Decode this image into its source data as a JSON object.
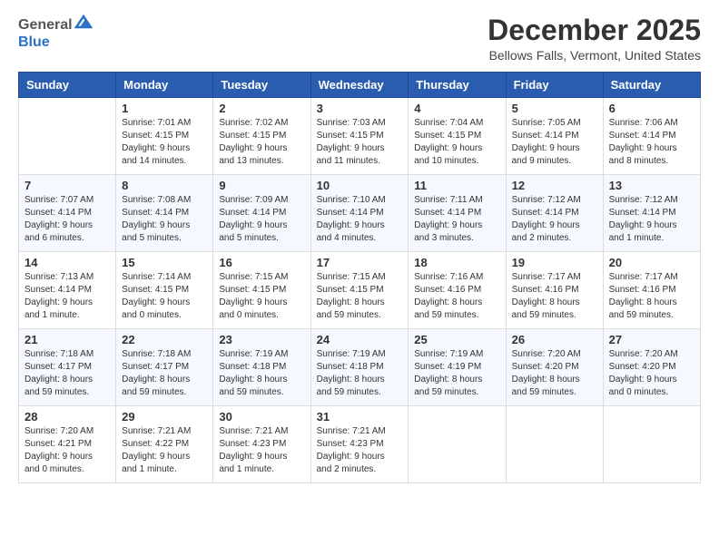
{
  "header": {
    "logo_general": "General",
    "logo_blue": "Blue",
    "month_title": "December 2025",
    "location": "Bellows Falls, Vermont, United States"
  },
  "weekdays": [
    "Sunday",
    "Monday",
    "Tuesday",
    "Wednesday",
    "Thursday",
    "Friday",
    "Saturday"
  ],
  "weeks": [
    [
      {
        "day": "",
        "info": ""
      },
      {
        "day": "1",
        "info": "Sunrise: 7:01 AM\nSunset: 4:15 PM\nDaylight: 9 hours\nand 14 minutes."
      },
      {
        "day": "2",
        "info": "Sunrise: 7:02 AM\nSunset: 4:15 PM\nDaylight: 9 hours\nand 13 minutes."
      },
      {
        "day": "3",
        "info": "Sunrise: 7:03 AM\nSunset: 4:15 PM\nDaylight: 9 hours\nand 11 minutes."
      },
      {
        "day": "4",
        "info": "Sunrise: 7:04 AM\nSunset: 4:15 PM\nDaylight: 9 hours\nand 10 minutes."
      },
      {
        "day": "5",
        "info": "Sunrise: 7:05 AM\nSunset: 4:14 PM\nDaylight: 9 hours\nand 9 minutes."
      },
      {
        "day": "6",
        "info": "Sunrise: 7:06 AM\nSunset: 4:14 PM\nDaylight: 9 hours\nand 8 minutes."
      }
    ],
    [
      {
        "day": "7",
        "info": "Sunrise: 7:07 AM\nSunset: 4:14 PM\nDaylight: 9 hours\nand 6 minutes."
      },
      {
        "day": "8",
        "info": "Sunrise: 7:08 AM\nSunset: 4:14 PM\nDaylight: 9 hours\nand 5 minutes."
      },
      {
        "day": "9",
        "info": "Sunrise: 7:09 AM\nSunset: 4:14 PM\nDaylight: 9 hours\nand 5 minutes."
      },
      {
        "day": "10",
        "info": "Sunrise: 7:10 AM\nSunset: 4:14 PM\nDaylight: 9 hours\nand 4 minutes."
      },
      {
        "day": "11",
        "info": "Sunrise: 7:11 AM\nSunset: 4:14 PM\nDaylight: 9 hours\nand 3 minutes."
      },
      {
        "day": "12",
        "info": "Sunrise: 7:12 AM\nSunset: 4:14 PM\nDaylight: 9 hours\nand 2 minutes."
      },
      {
        "day": "13",
        "info": "Sunrise: 7:12 AM\nSunset: 4:14 PM\nDaylight: 9 hours\nand 1 minute."
      }
    ],
    [
      {
        "day": "14",
        "info": "Sunrise: 7:13 AM\nSunset: 4:14 PM\nDaylight: 9 hours\nand 1 minute."
      },
      {
        "day": "15",
        "info": "Sunrise: 7:14 AM\nSunset: 4:15 PM\nDaylight: 9 hours\nand 0 minutes."
      },
      {
        "day": "16",
        "info": "Sunrise: 7:15 AM\nSunset: 4:15 PM\nDaylight: 9 hours\nand 0 minutes."
      },
      {
        "day": "17",
        "info": "Sunrise: 7:15 AM\nSunset: 4:15 PM\nDaylight: 8 hours\nand 59 minutes."
      },
      {
        "day": "18",
        "info": "Sunrise: 7:16 AM\nSunset: 4:16 PM\nDaylight: 8 hours\nand 59 minutes."
      },
      {
        "day": "19",
        "info": "Sunrise: 7:17 AM\nSunset: 4:16 PM\nDaylight: 8 hours\nand 59 minutes."
      },
      {
        "day": "20",
        "info": "Sunrise: 7:17 AM\nSunset: 4:16 PM\nDaylight: 8 hours\nand 59 minutes."
      }
    ],
    [
      {
        "day": "21",
        "info": "Sunrise: 7:18 AM\nSunset: 4:17 PM\nDaylight: 8 hours\nand 59 minutes."
      },
      {
        "day": "22",
        "info": "Sunrise: 7:18 AM\nSunset: 4:17 PM\nDaylight: 8 hours\nand 59 minutes."
      },
      {
        "day": "23",
        "info": "Sunrise: 7:19 AM\nSunset: 4:18 PM\nDaylight: 8 hours\nand 59 minutes."
      },
      {
        "day": "24",
        "info": "Sunrise: 7:19 AM\nSunset: 4:18 PM\nDaylight: 8 hours\nand 59 minutes."
      },
      {
        "day": "25",
        "info": "Sunrise: 7:19 AM\nSunset: 4:19 PM\nDaylight: 8 hours\nand 59 minutes."
      },
      {
        "day": "26",
        "info": "Sunrise: 7:20 AM\nSunset: 4:20 PM\nDaylight: 8 hours\nand 59 minutes."
      },
      {
        "day": "27",
        "info": "Sunrise: 7:20 AM\nSunset: 4:20 PM\nDaylight: 9 hours\nand 0 minutes."
      }
    ],
    [
      {
        "day": "28",
        "info": "Sunrise: 7:20 AM\nSunset: 4:21 PM\nDaylight: 9 hours\nand 0 minutes."
      },
      {
        "day": "29",
        "info": "Sunrise: 7:21 AM\nSunset: 4:22 PM\nDaylight: 9 hours\nand 1 minute."
      },
      {
        "day": "30",
        "info": "Sunrise: 7:21 AM\nSunset: 4:23 PM\nDaylight: 9 hours\nand 1 minute."
      },
      {
        "day": "31",
        "info": "Sunrise: 7:21 AM\nSunset: 4:23 PM\nDaylight: 9 hours\nand 2 minutes."
      },
      {
        "day": "",
        "info": ""
      },
      {
        "day": "",
        "info": ""
      },
      {
        "day": "",
        "info": ""
      }
    ]
  ]
}
